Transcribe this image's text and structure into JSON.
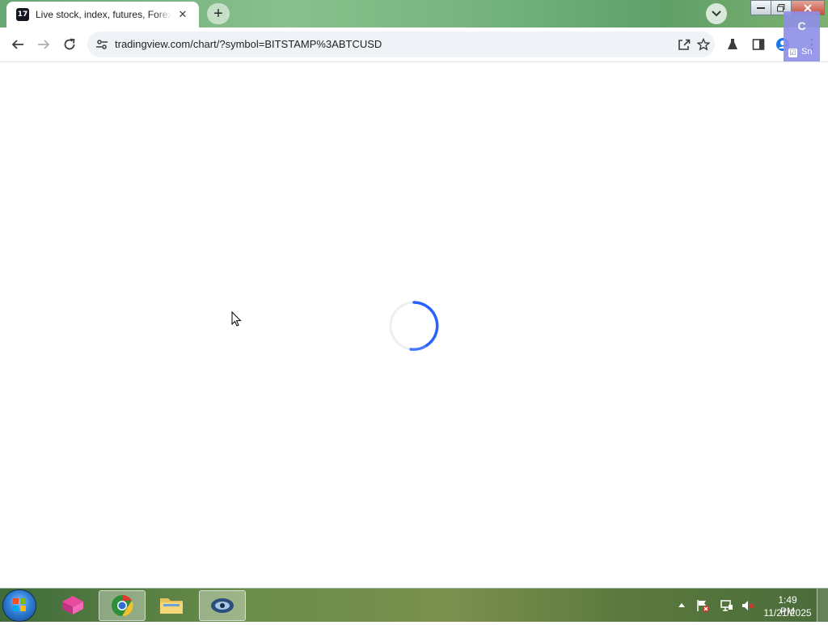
{
  "browser": {
    "tab": {
      "title": "Live stock, index, futures, Forex and Bitcoin charts on TradingView",
      "favicon_text": "17",
      "close_glyph": "✕"
    },
    "new_tab_glyph": "+",
    "url": "tradingview.com/chart/?symbol=BITSTAMP%3ABTCUSD",
    "icons": [
      "back-icon",
      "forward-icon",
      "reload-icon",
      "site-info-icon",
      "share-icon",
      "star-icon",
      "labs-icon",
      "side-panel-icon",
      "profile-icon",
      "menu-icon"
    ]
  },
  "overlay": {
    "letter": "C",
    "checkbox": "☑",
    "text": "Sn"
  },
  "content": {
    "state": "loading",
    "spinner_color": "#2962ff"
  },
  "taskbar": {
    "clock_time": "1:49 PM",
    "clock_date": "11/21/2025",
    "items": [
      "app-pink-icon",
      "chrome-icon",
      "explorer-icon",
      "network-app-icon"
    ]
  },
  "colors": {
    "omnibox_bg": "#eff3f8",
    "overlay_bg": "#8f8fe8"
  }
}
